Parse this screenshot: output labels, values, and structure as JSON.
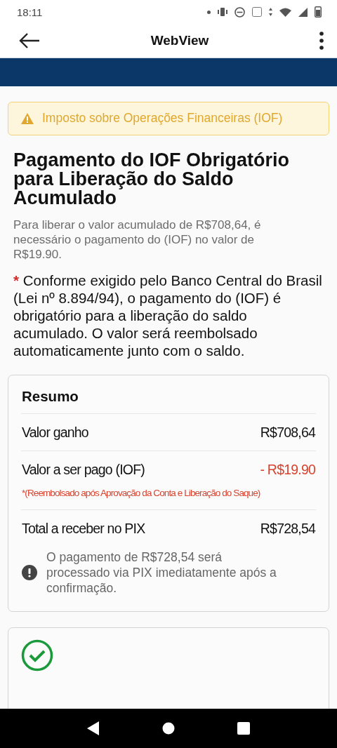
{
  "status_bar": {
    "time": "18:11"
  },
  "app_bar": {
    "title": "WebView"
  },
  "alert": {
    "text": "Imposto sobre Operações Financeiras (IOF)"
  },
  "heading": "Pagamento do IOF Obrigatório para Liberação do Saldo Acumulado",
  "subtitle": "Para liberar o valor acumulado de R$708,64, é necessário o pagamento do (IOF) no valor de R$19.90.",
  "notice": {
    "mark": "*",
    "text": "Conforme exigido pelo Banco Central do Brasil (Lei nº 8.894/94), o pagamento do (IOF) é obrigatório para a liberação do saldo acumulado. O valor será reembolsado automaticamente junto com o saldo."
  },
  "summary": {
    "title": "Resumo",
    "rows": [
      {
        "label": "Valor ganho",
        "value": "R$708,64",
        "kind": "normal"
      },
      {
        "label": "Valor a ser pago (IOF)",
        "value": "- R$19.90",
        "kind": "deduction",
        "footnote": "*(Reembolsado após Aprovação da Conta e Liberação do Saque)"
      },
      {
        "label": "Total a receber no PIX",
        "value": "R$728,54",
        "kind": "total"
      }
    ],
    "info": "O pagamento de R$728,54 será processado via PIX imediatamente após a confirmação."
  }
}
